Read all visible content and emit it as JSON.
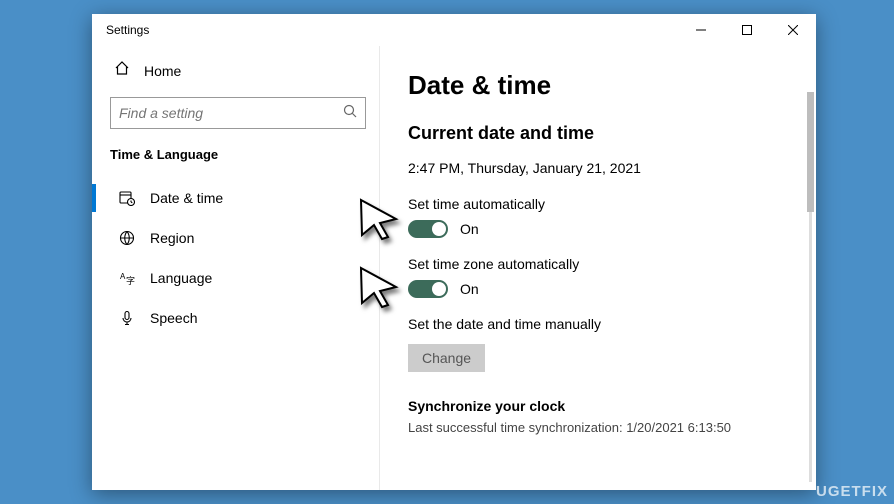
{
  "window": {
    "title": "Settings"
  },
  "sidebar": {
    "home": "Home",
    "search_placeholder": "Find a setting",
    "section": "Time & Language",
    "items": [
      {
        "label": "Date & time"
      },
      {
        "label": "Region"
      },
      {
        "label": "Language"
      },
      {
        "label": "Speech"
      }
    ]
  },
  "main": {
    "heading": "Date & time",
    "subheading": "Current date and time",
    "current": "2:47 PM, Thursday, January 21, 2021",
    "auto_time_label": "Set time automatically",
    "auto_time_status": "On",
    "auto_tz_label": "Set time zone automatically",
    "auto_tz_status": "On",
    "manual_label": "Set the date and time manually",
    "change_btn": "Change",
    "sync_heading": "Synchronize your clock",
    "sync_last": "Last successful time synchronization: 1/20/2021 6:13:50"
  },
  "watermark": "UGETFIX"
}
